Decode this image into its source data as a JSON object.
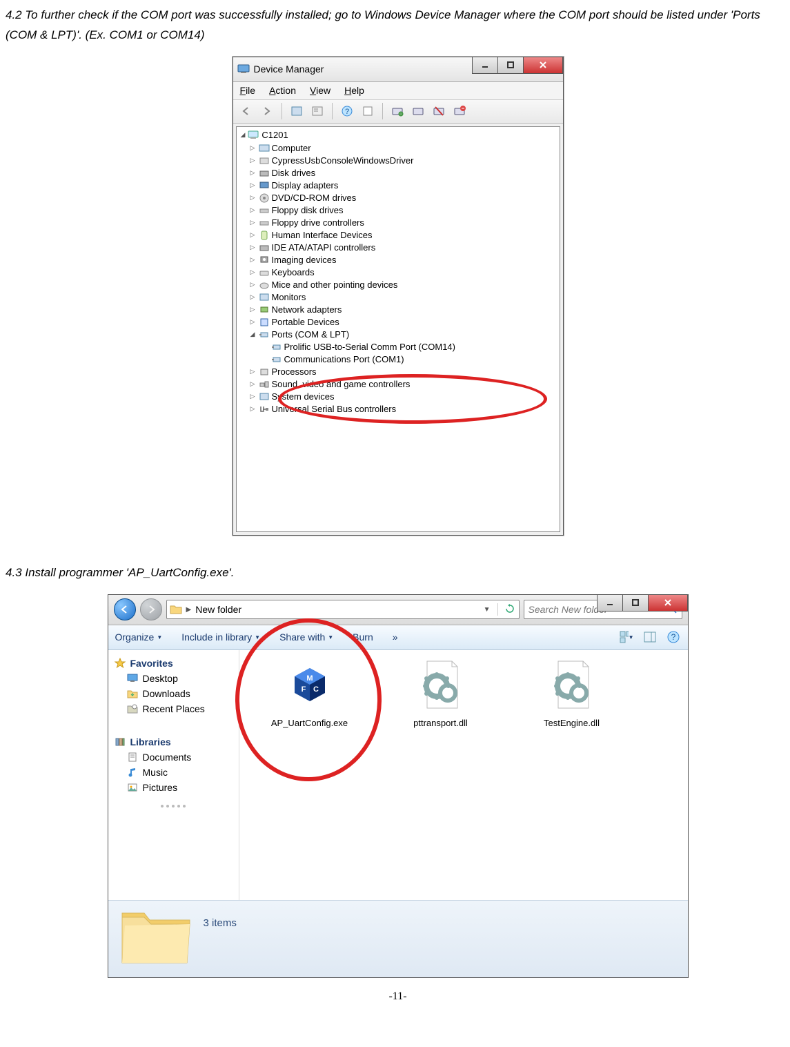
{
  "section4_2": {
    "text": "4.2   To further check if the COM port was successfully installed; go to Windows Device Manager where the COM port should be listed under 'Ports (COM & LPT)'. (Ex. COM1 or COM14)"
  },
  "section4_3": {
    "text": "4.3   Install programmer 'AP_UartConfig.exe'."
  },
  "device_manager": {
    "title": "Device Manager",
    "menu": {
      "file": "File",
      "action": "Action",
      "view": "View",
      "help": "Help"
    },
    "tree_root": "C1201",
    "nodes": [
      "Computer",
      "CypressUsbConsoleWindowsDriver",
      "Disk drives",
      "Display adapters",
      "DVD/CD-ROM drives",
      "Floppy disk drives",
      "Floppy drive controllers",
      "Human Interface Devices",
      "IDE ATA/ATAPI controllers",
      "Imaging devices",
      "Keyboards",
      "Mice and other pointing devices",
      "Monitors",
      "Network adapters",
      "Portable Devices"
    ],
    "ports_node": "Ports (COM & LPT)",
    "ports_children": [
      "Prolific USB-to-Serial Comm Port (COM14)",
      "Communications Port (COM1)"
    ],
    "nodes_after": [
      "Processors",
      "Sound, video and game controllers",
      "System devices",
      "Universal Serial Bus controllers"
    ]
  },
  "explorer": {
    "address_bar": {
      "caret": "▶",
      "folder_label": "New folder"
    },
    "search": {
      "placeholder": "Search New folder"
    },
    "toolbar": {
      "organize": "Organize",
      "include": "Include in library",
      "share": "Share with",
      "burn": "Burn",
      "more": "»"
    },
    "sidebar": {
      "favorites": "Favorites",
      "fav_items": [
        "Desktop",
        "Downloads",
        "Recent Places"
      ],
      "libraries": "Libraries",
      "lib_items": [
        "Documents",
        "Music",
        "Pictures"
      ]
    },
    "files": [
      {
        "name": "AP_UartConfig.exe"
      },
      {
        "name": "pttransport.dll"
      },
      {
        "name": "TestEngine.dll"
      }
    ],
    "status_text": "3 items"
  },
  "page_number": "-11-"
}
